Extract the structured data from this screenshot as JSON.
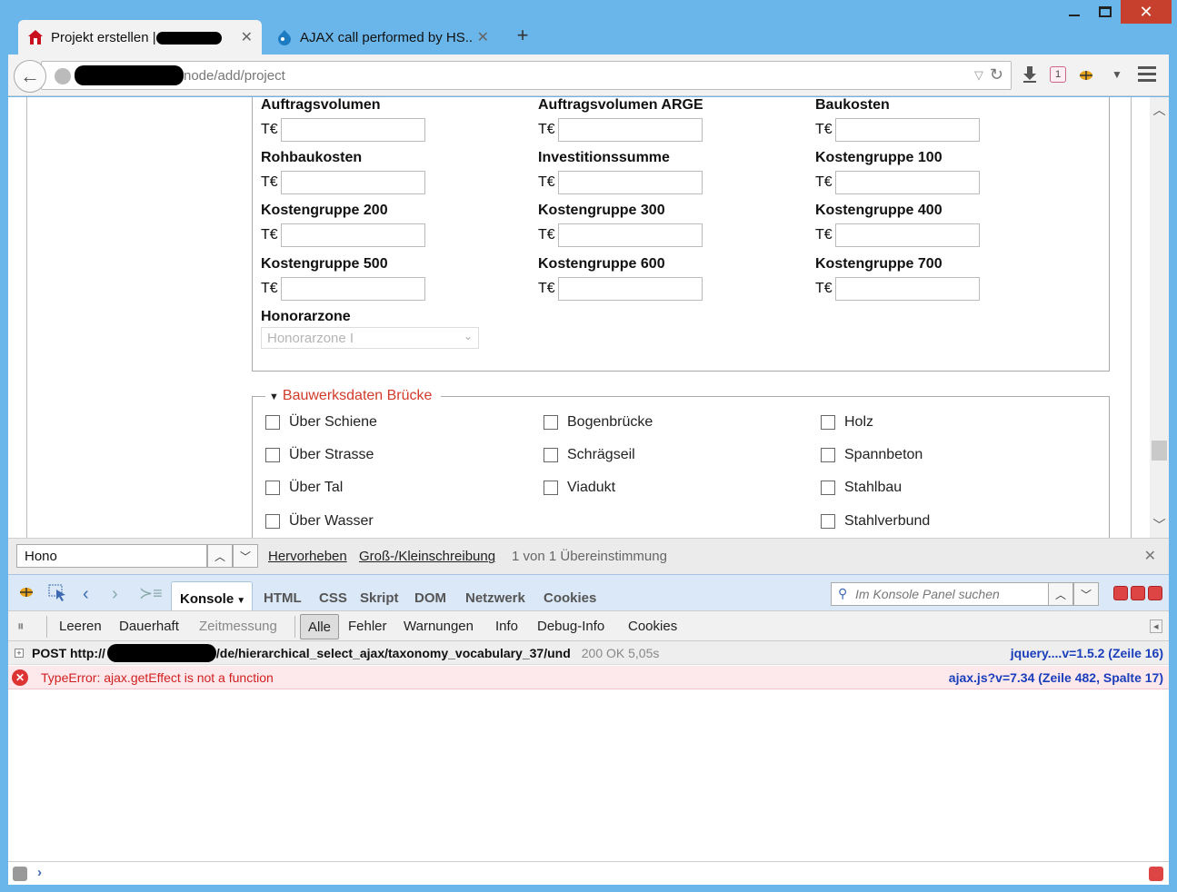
{
  "window": {
    "controls": {
      "minimize": "",
      "maximize": "",
      "close": "✕"
    }
  },
  "tabs": [
    {
      "label": "Projekt erstellen |",
      "close": "✕"
    },
    {
      "label": "AJAX call performed by HS...",
      "close": "✕"
    }
  ],
  "new_tab": "+",
  "navbar": {
    "url": "node/add/project",
    "badge_count": "1"
  },
  "form": {
    "currency": "T€",
    "fields": [
      {
        "label": "Auftragsvolumen"
      },
      {
        "label": "Auftragsvolumen ARGE"
      },
      {
        "label": "Baukosten"
      },
      {
        "label": "Rohbaukosten"
      },
      {
        "label": "Investitionssumme"
      },
      {
        "label": "Kostengruppe 100"
      },
      {
        "label": "Kostengruppe 200"
      },
      {
        "label": "Kostengruppe 300"
      },
      {
        "label": "Kostengruppe 400"
      },
      {
        "label": "Kostengruppe 500"
      },
      {
        "label": "Kostengruppe 600"
      },
      {
        "label": "Kostengruppe 700"
      }
    ],
    "honorarzone_label": "Honorarzone",
    "honorarzone_value": "Honorarzone I"
  },
  "bauwerk": {
    "legend": "Bauwerksdaten Brücke",
    "col1": [
      "Über Schiene",
      "Über Strasse",
      "Über Tal",
      "Über Wasser"
    ],
    "col2": [
      "Bogenbrücke",
      "Schrägseil",
      "Viadukt"
    ],
    "col3": [
      "Holz",
      "Spannbeton",
      "Stahlbau",
      "Stahlverbund"
    ]
  },
  "findbar": {
    "query": "Hono",
    "highlight": "Hervorheben",
    "matchcase": "Groß-/Kleinschreibung",
    "status": "1 von 1 Übereinstimmung"
  },
  "firebug": {
    "tabs": [
      "Konsole",
      "HTML",
      "CSS",
      "Skript",
      "DOM",
      "Netzwerk",
      "Cookies"
    ],
    "search_placeholder": "Im Konsole Panel suchen",
    "filters": [
      "Leeren",
      "Dauerhaft",
      "Zeitmessung",
      "Alle",
      "Fehler",
      "Warnungen",
      "Info",
      "Debug-Info",
      "Cookies"
    ],
    "log": [
      {
        "prefix": "POST http://",
        "path": "/de/hierarchical_select_ajax/taxonomy_vocabulary_37/und",
        "status": "200 OK 5,05s",
        "source": "jquery....v=1.5.2 (Zeile 16)"
      },
      {
        "message": "TypeError: ajax.getEffect is not a function",
        "source": "ajax.js?v=7.34 (Zeile 482, Spalte 17)"
      }
    ],
    "prompt": "›"
  }
}
